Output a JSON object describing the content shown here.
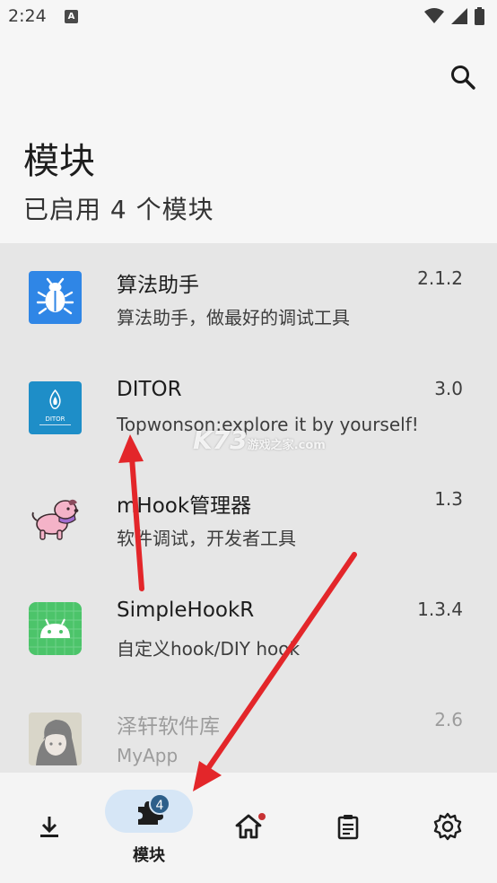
{
  "status": {
    "time": "2:24",
    "notif_glyph": "A"
  },
  "header": {
    "title": "模块",
    "subtitle": "已启用 4 个模块"
  },
  "modules": [
    {
      "name": "算法助手",
      "desc": "算法助手，做最好的调试工具",
      "version": "2.1.2",
      "icon": "bug-icon"
    },
    {
      "name": "DITOR",
      "desc": "Topwonson:explore it by yourself!",
      "version": "3.0",
      "icon": "flame-logo-icon",
      "icon_text": "DITOR"
    },
    {
      "name": "mHook管理器",
      "desc": "软件调试，开发者工具",
      "version": "1.3",
      "icon": "dog-icon"
    },
    {
      "name": "SimpleHookR",
      "desc": "自定义hook/DIY hook",
      "version": "1.3.4",
      "icon": "android-icon"
    },
    {
      "name": "泽轩软件库",
      "desc": "MyApp",
      "version": "2.6",
      "icon": "anime-avatar-icon"
    }
  ],
  "nav": {
    "items": [
      {
        "label": "",
        "icon": "download-icon"
      },
      {
        "label": "模块",
        "icon": "puzzle-icon",
        "badge": "4",
        "active": true
      },
      {
        "label": "",
        "icon": "home-icon",
        "has_dot": true
      },
      {
        "label": "",
        "icon": "clipboard-icon"
      },
      {
        "label": "",
        "icon": "gear-icon"
      }
    ]
  },
  "watermark": {
    "brand": "K73",
    "sub": "游戏之家",
    "domain": ".com"
  },
  "colors": {
    "accent": "#2d5f8a",
    "pill": "#d6e6f6",
    "annotation": "#e3262a"
  }
}
